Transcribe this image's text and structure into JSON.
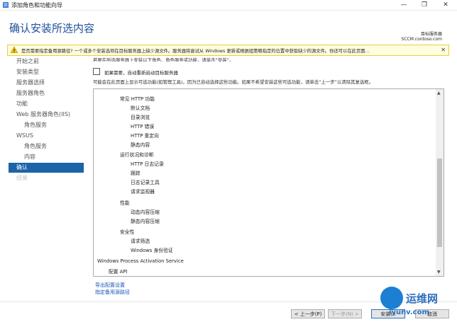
{
  "window": {
    "title": "添加角色和功能向导",
    "min": "—",
    "max": "❐",
    "close": "✕"
  },
  "header": {
    "title": "确认安装所选内容",
    "dest_label": "目标服务器",
    "dest_server": "SCCM.contoso.com"
  },
  "warning": {
    "text": "是否需要指定备用源路径? 一个或多个安装选项在目标服务器上缺少源文件。服务器将尝试从 Windows 更新或根据组策略指定的位置中获取缺少的源文件。你还可以在此页面...",
    "close": "✕"
  },
  "sidebar": {
    "items": [
      {
        "label": "开始之前",
        "state": "normal",
        "sub": false
      },
      {
        "label": "安装类型",
        "state": "normal",
        "sub": false
      },
      {
        "label": "服务器选择",
        "state": "normal",
        "sub": false
      },
      {
        "label": "服务器角色",
        "state": "normal",
        "sub": false
      },
      {
        "label": "功能",
        "state": "normal",
        "sub": false
      },
      {
        "label": "Web 服务器角色(IIS)",
        "state": "normal",
        "sub": false
      },
      {
        "label": "角色服务",
        "state": "normal",
        "sub": true
      },
      {
        "label": "WSUS",
        "state": "normal",
        "sub": false
      },
      {
        "label": "角色服务",
        "state": "normal",
        "sub": true
      },
      {
        "label": "内容",
        "state": "normal",
        "sub": true
      },
      {
        "label": "确认",
        "state": "active",
        "sub": false
      },
      {
        "label": "结果",
        "state": "disabled",
        "sub": false
      }
    ]
  },
  "main": {
    "cut_text": "若要在所选服务器上安装以下角色、角色服务或功能，请单击“安装”。",
    "restart_checkbox": {
      "label": "如果需要，自动重新启动目标服务器",
      "checked": false
    },
    "info": "可能会在此页面上显示可选功能(如管理工具)，因为已自动选择这些功能。如果不希望安装这些可选功能，请单击“上一步”以清除其复选框。",
    "features": [
      {
        "label": "常见 HTTP 功能",
        "level": 0
      },
      {
        "label": "默认文档",
        "level": 1
      },
      {
        "label": "目录浏览",
        "level": 1
      },
      {
        "label": "HTTP 错误",
        "level": 1
      },
      {
        "label": "HTTP 重定向",
        "level": 1
      },
      {
        "label": "静态内容",
        "level": 1
      },
      {
        "label": "运行状况和诊断",
        "level": 0
      },
      {
        "label": "HTTP 日志记录",
        "level": 1
      },
      {
        "label": "跟踪",
        "level": 1
      },
      {
        "label": "日志记录工具",
        "level": 1
      },
      {
        "label": "请求监视器",
        "level": 1
      },
      {
        "label": "性能",
        "level": 0
      },
      {
        "label": "动态内容压缩",
        "level": 1
      },
      {
        "label": "静态内容压缩",
        "level": 1
      },
      {
        "label": "安全性",
        "level": 0
      },
      {
        "label": "请求筛选",
        "level": 1
      },
      {
        "label": "Windows 身份验证",
        "level": 1
      },
      {
        "label": "Windows Process Activation Service",
        "level": -1
      },
      {
        "label": "配置 API",
        "level": -0.5
      }
    ],
    "export_link": "导出配置设置",
    "alt_source_link": "指定备用源路径"
  },
  "footer": {
    "prev_label": "< 上一步(P)",
    "next_label": "下一步(N) >",
    "install_label": "安装(I)",
    "cancel_label": "取消"
  },
  "watermark": {
    "text": "运维网",
    "url": "iyunv.com"
  },
  "colors": {
    "accent": "#1c63a8",
    "title": "#1f4e9a",
    "warning_bg": "#fffde0",
    "link": "#1a56b8"
  }
}
